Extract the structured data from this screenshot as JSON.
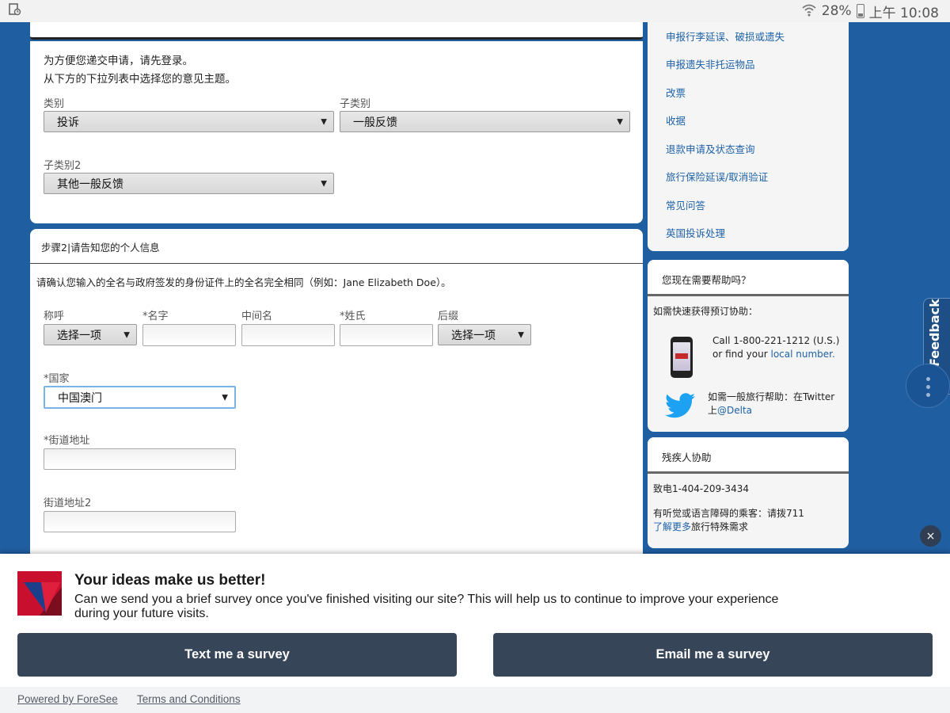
{
  "statusbar": {
    "battery": "28%",
    "time": "上午 10:08"
  },
  "step1": {
    "intro_line1": "为方便您递交申请，请先登录。",
    "intro_line2": "从下方的下拉列表中选择您的意见主题。",
    "category_label": "类别",
    "category_value": "投诉",
    "subcategory_label": "子类别",
    "subcategory_value": "一般反馈",
    "subcategory2_label": "子类别2",
    "subcategory2_value": "其他一般反馈"
  },
  "step2": {
    "header": "步骤2|请告知您的个人信息",
    "note": "请确认您输入的全名与政府签发的身份证件上的全名完全相同（例如：Jane Elizabeth Doe）。",
    "salutation_label": "称呼",
    "salutation_value": "选择一项",
    "first_name_label": "*名字",
    "middle_name_label": "中间名",
    "last_name_label": "*姓氏",
    "suffix_label": "后缀",
    "suffix_value": "选择一项",
    "country_label": "*国家",
    "country_value": "中国澳门",
    "street_label": "*街道地址",
    "street2_label": "街道地址2"
  },
  "sidebar": {
    "links": [
      "申报行李延误、破损或遗失",
      "申报遗失非托运物品",
      "改票",
      "收据",
      "退款申请及状态查询",
      "旅行保险延误/取消验证",
      "常见问答",
      "英国投诉处理"
    ],
    "help": {
      "title": "您现在需要帮助吗？",
      "booking_label": "如需快速获得预订协助：",
      "call_text": "Call 1-800-221-1212 (U.S.)",
      "find_text": "or find your ",
      "local_link": "local number.",
      "twitter_text": "如需一般旅行帮助：在Twitter",
      "twitter_prefix": "上",
      "twitter_handle": "@Delta"
    },
    "disability": {
      "title": "残疾人协助",
      "phone": "致电1-404-209-3434",
      "hearing_text": "有听觉或语言障碍的乘客：请拨711",
      "learn_more": "了解更多",
      "learn_more_suffix": "旅行特殊需求"
    }
  },
  "feedback_tab": {
    "label": "Feedback"
  },
  "close_glyph": "×",
  "survey": {
    "title": "Your ideas make us better!",
    "body": "Can we send you a brief survey once you've finished visiting our site? This will help us to continue to improve your experience during your future visits.",
    "text_button": "Text me a survey",
    "email_button": "Email me a survey",
    "powered_by": "Powered by ForeSee",
    "terms": "Terms and Conditions"
  },
  "colors": {
    "brand_blue": "#1f5ea0",
    "link_blue": "#1d61a8",
    "survey_button": "#374559",
    "delta_red": "#c8102e"
  }
}
